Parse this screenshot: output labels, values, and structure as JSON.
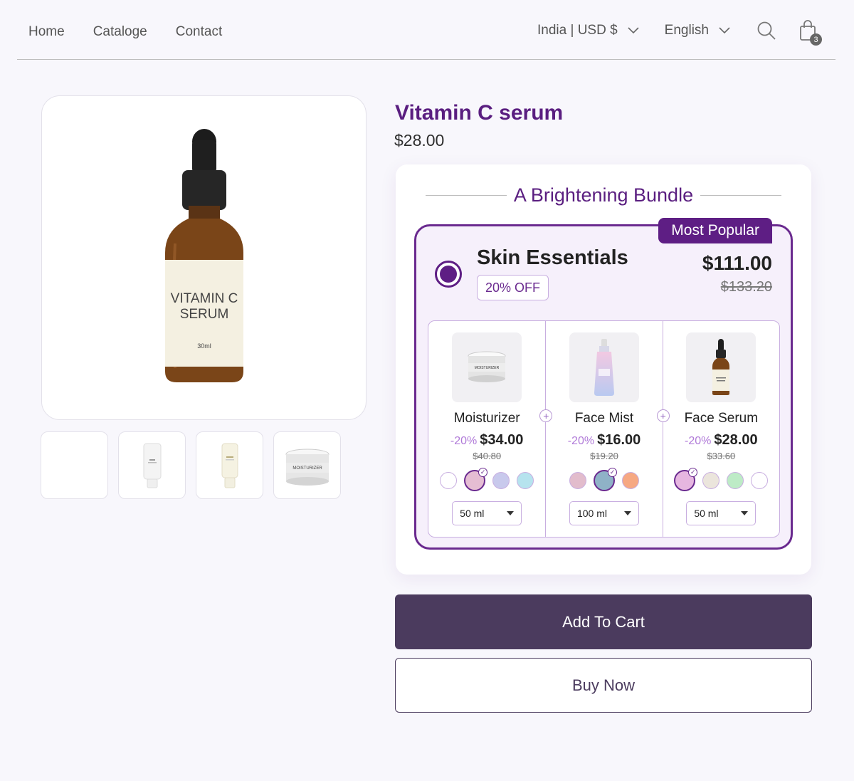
{
  "nav": {
    "links": [
      "Home",
      "Cataloge",
      "Contact"
    ],
    "currency": "India | USD $",
    "language": "English",
    "cart_count": "3"
  },
  "product": {
    "title": "Vitamin C serum",
    "price": "$28.00",
    "image_label_line1": "VITAMIN C",
    "image_label_line2": "SERUM",
    "image_volume": "30ml",
    "thumbnails": [
      "",
      "cleanser",
      "spf",
      "moisturizer"
    ]
  },
  "bundle": {
    "heading": "A Brightening Bundle",
    "tag": "Most Popular",
    "option_name": "Skin Essentials",
    "discount": "20% OFF",
    "price": "$111.00",
    "compare_price": "$133.20",
    "items": [
      {
        "name": "Moisturizer",
        "discount": "-20%",
        "price": "$34.00",
        "compare": "$40.80",
        "size": "50 ml",
        "swatches": [
          "#ffffff",
          "#e5bdd3",
          "#c8c9ec",
          "#b6e3ee"
        ],
        "selected_swatch": 1
      },
      {
        "name": "Face Mist",
        "discount": "-20%",
        "price": "$16.00",
        "compare": "$19.20",
        "size": "100 ml",
        "swatches": [
          "#e2bccc",
          "#8fb2c7",
          "#f6a882"
        ],
        "selected_swatch": 1
      },
      {
        "name": "Face Serum",
        "discount": "-20%",
        "price": "$28.00",
        "compare": "$33.60",
        "size": "50 ml",
        "swatches": [
          "#e6b6e0",
          "#ebe5dc",
          "#bdebc6",
          "#ffffff"
        ],
        "selected_swatch": 0
      }
    ]
  },
  "actions": {
    "add_to_cart": "Add To Cart",
    "buy_now": "Buy Now"
  },
  "colors": {
    "brand": "#5a1e80",
    "button_dark": "#4b3b5e",
    "background": "#f8f7fc"
  }
}
